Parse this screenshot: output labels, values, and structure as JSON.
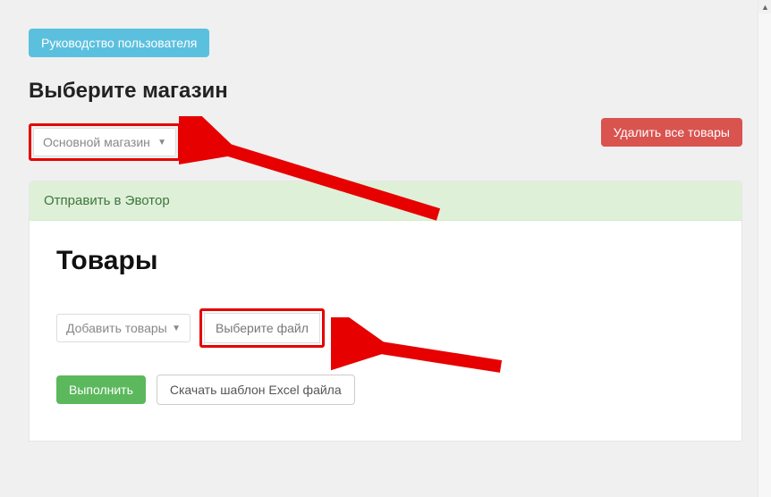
{
  "header": {
    "user_guide_label": "Руководство пользователя"
  },
  "store": {
    "title": "Выберите магазин",
    "selected": "Основной магазин"
  },
  "actions": {
    "delete_all_label": "Удалить все товары"
  },
  "panel": {
    "header_label": "Отправить в Эвотор",
    "products_title": "Товары",
    "add_select_label": "Добавить товары",
    "choose_file_label": "Выберите файл",
    "execute_label": "Выполнить",
    "download_template_label": "Скачать шаблон Excel файла"
  }
}
